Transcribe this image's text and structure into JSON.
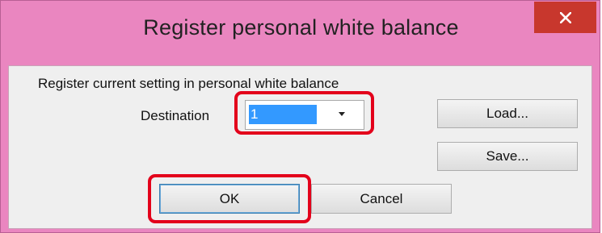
{
  "dialog": {
    "title": "Register personal white balance",
    "description": "Register current setting in personal white balance",
    "destination_label": "Destination",
    "destination_value": "1",
    "load_label": "Load...",
    "save_label": "Save...",
    "ok_label": "OK",
    "cancel_label": "Cancel"
  },
  "colors": {
    "titlebar": "#ea86c0",
    "close_button": "#c8372d",
    "highlight": "#e3001b",
    "selection": "#3399ff"
  },
  "icons": [
    "close-icon",
    "chevron-down-icon"
  ]
}
